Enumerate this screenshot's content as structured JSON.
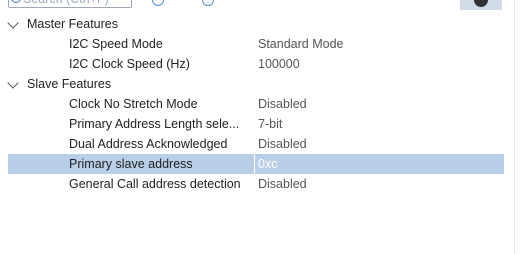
{
  "search": {
    "placeholder": "Search (Ctrl+F)"
  },
  "groups": [
    {
      "label": "Master Features",
      "properties": [
        {
          "name": "I2C Speed Mode",
          "value": "Standard Mode"
        },
        {
          "name": "I2C Clock Speed (Hz)",
          "value": "100000"
        }
      ]
    },
    {
      "label": "Slave Features",
      "properties": [
        {
          "name": "Clock No Stretch Mode",
          "value": "Disabled"
        },
        {
          "name": "Primary Address Length sele...",
          "value": "7-bit"
        },
        {
          "name": "Dual Address Acknowledged",
          "value": "Disabled"
        },
        {
          "name": "Primary slave address",
          "value": "0xc",
          "selected": true
        },
        {
          "name": "General Call address detection",
          "value": "Disabled"
        }
      ]
    }
  ],
  "icons": {
    "search": "search-icon",
    "expand_all": "expand-all-icon",
    "collapse_all": "collapse-all-icon",
    "info": "info-icon",
    "chevron": "chevron-down-icon"
  },
  "colors": {
    "selection": "#b9cfe7",
    "toolbar_icon": "#4a90d9"
  }
}
